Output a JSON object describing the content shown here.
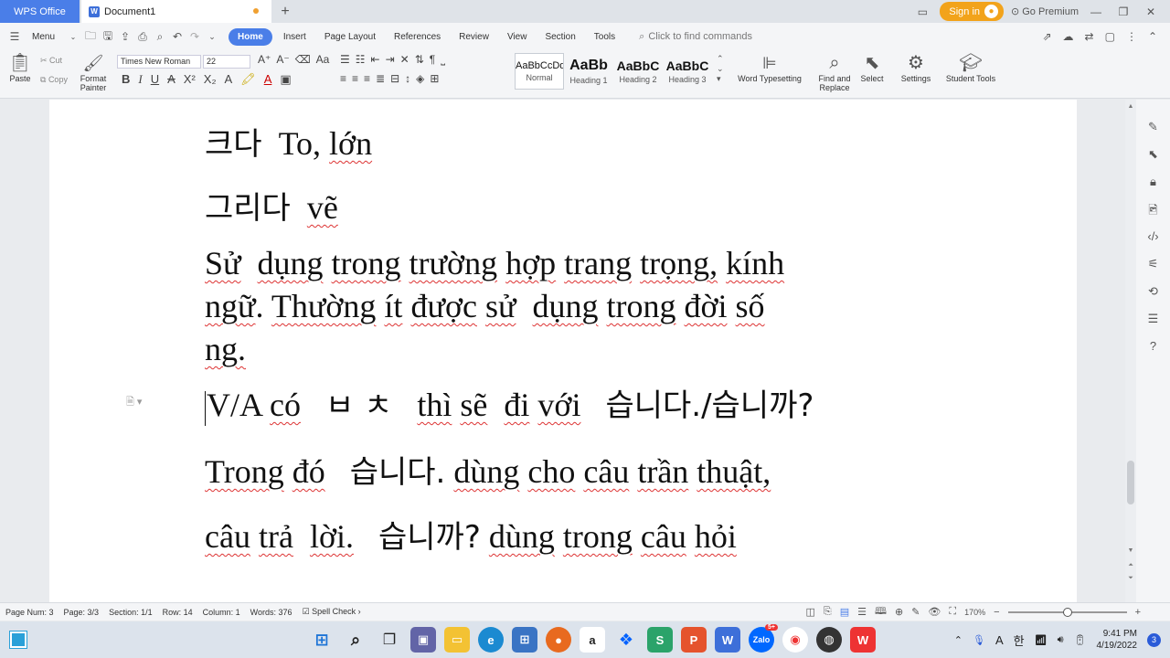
{
  "tabs": {
    "app": "WPS Office",
    "document": "Document1",
    "sign_in": "Sign in",
    "premium": "Go Premium"
  },
  "menu": {
    "menu_label": "Menu",
    "items": [
      "Home",
      "Insert",
      "Page Layout",
      "References",
      "Review",
      "View",
      "Section",
      "Tools"
    ],
    "find_placeholder": "Click to find commands"
  },
  "ribbon": {
    "paste": "Paste",
    "cut": "Cut",
    "copy": "Copy",
    "format_painter_1": "Format",
    "format_painter_2": "Painter",
    "font": "Times New Roman",
    "size": "22",
    "styles": [
      {
        "preview": "AaBbCcDd",
        "label": "Normal"
      },
      {
        "preview": "AaBb",
        "label": "Heading 1"
      },
      {
        "preview": "AaBbC",
        "label": "Heading 2"
      },
      {
        "preview": "AaBbC",
        "label": "Heading 3"
      }
    ],
    "word_typesetting": "Word Typesetting",
    "find_replace_1": "Find and",
    "find_replace_2": "Replace",
    "select": "Select",
    "settings": "Settings",
    "student_tools": "Student Tools"
  },
  "document": {
    "l1_ko": "크다",
    "l1_vi_a": "To, ",
    "l1_vi_b": "lớn",
    "l2_ko": "그리다",
    "l2_vi": "vẽ",
    "l3a": "Sử",
    "l3b": "dụng",
    "l3c": "trong",
    "l3d": "trường",
    "l3e": "hợp",
    "l3f": "trang",
    "l3g": "trọng,",
    "l3h": "kính",
    "l4a": "ngữ",
    "l4b": ". ",
    "l4c": "Thường",
    "l4d": "ít",
    "l4e": "được",
    "l4f": "sử",
    "l4g": "dụng",
    "l4h": "trong",
    "l4i": "đời",
    "l4j": "số",
    "l5": "ng.",
    "l6a": "V/A",
    "l6b": "có",
    "l6c": "ㅂ ㅊ",
    "l6d": "thì",
    "l6e": "sẽ",
    "l6f": "đi",
    "l6g": "với",
    "l6h": "습니다./습니까?",
    "l7a": "Trong",
    "l7b": "đó",
    "l7c": "습니다.",
    "l7d": "dùng",
    "l7e": "cho",
    "l7f": "câu",
    "l7g": "trần",
    "l7h": "thuật,",
    "l8a": "câu",
    "l8b": "trả",
    "l8c": "lời.",
    "l8d": "습니까?",
    "l8e": "dùng",
    "l8f": "trong",
    "l8g": "câu",
    "l8h": "hỏi"
  },
  "status": {
    "page_num": "Page Num: 3",
    "page": "Page: 3/3",
    "section": "Section: 1/1",
    "row": "Row: 14",
    "column": "Column: 1",
    "words": "Words: 376",
    "spell": "Spell Check",
    "zoom": "170%",
    "zoom_level": 0.5
  },
  "taskbar": {
    "time": "9:41 PM",
    "date": "4/19/2022",
    "lang": "한",
    "notifications": "3",
    "zalo_badge": "5+",
    "input_label": "A"
  },
  "colors": {
    "accent": "#4a7ee8",
    "signin": "#f2a31b",
    "spell_underline": "#dd3333"
  }
}
